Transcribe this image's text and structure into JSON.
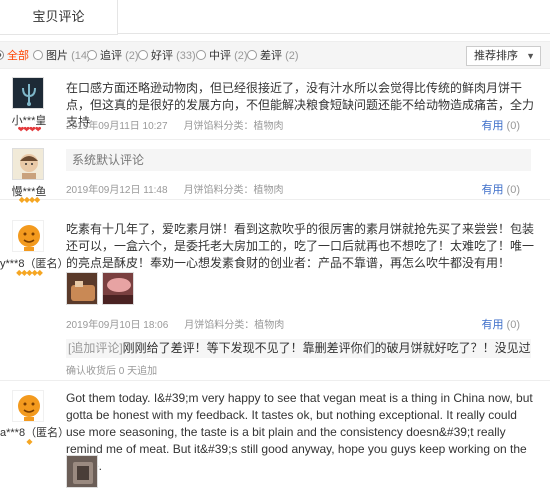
{
  "tab": {
    "label": "宝贝评论"
  },
  "filters": [
    {
      "label": "全部",
      "count": "",
      "checked": true
    },
    {
      "label": "图片",
      "count": "(14)",
      "checked": false
    },
    {
      "label": "追评",
      "count": "(2)",
      "checked": false
    },
    {
      "label": "好评",
      "count": "(33)",
      "checked": false
    },
    {
      "label": "中评",
      "count": "(2)",
      "checked": false
    },
    {
      "label": "差评",
      "count": "(2)",
      "checked": false
    }
  ],
  "sort": {
    "label": "推荐排序",
    "arrow": "▼"
  },
  "reviews": [
    {
      "user": "小***皇",
      "badges": "❤❤❤❤",
      "badge_color": "#e4393c",
      "content": "在口感方面还略逊动物肉，但已经很接近了，没有汁水所以会觉得比传统的鲜肉月饼干点，但这真的是很好的发展方向，不但能解决粮食短缺问题还能不给动物造成痛苦，全力支持",
      "date": "2019年09月11日 10:27",
      "category": "月饼馅料分类：植物肉",
      "useful_label": "有用",
      "useful_count": "(0)"
    },
    {
      "user": "慢***鱼",
      "badges": "◆◆◆◆",
      "badge_color": "#f5a623",
      "content": "系统默认评论",
      "date": "2019年09月12日 11:48",
      "category": "月饼馅料分类：植物肉",
      "useful_label": "有用",
      "useful_count": "(0)"
    },
    {
      "user": "y***8（匿名）",
      "badges": "◆◆◆◆◆",
      "badge_color": "#f5a623",
      "content": "吃素有十几年了，爱吃素月饼！看到这款吹乎的很厉害的素月饼就抢先买了来尝尝！包装还可以，一盒六个，是委托老大房加工的，吃了一口后就再也不想吃了！太难吃了！唯一的亮点是酥皮！奉劝一心想发素食财的创业者：产品不靠谱，再怎么吹牛都没有用！",
      "date": "2019年09月10日 18:06",
      "category": "月饼馅料分类：植物肉",
      "useful_label": "有用",
      "useful_count": "(0)",
      "append_tag": "[追加评论]",
      "append_text": "刚刚给了差评！等下发现不见了！靠删差评你们的破月饼就好吃了？！没见过这么差的！",
      "append_meta": "确认收货后 0 天追加"
    },
    {
      "user": "a***8（匿名）",
      "badges": "◆",
      "badge_color": "#f5a623",
      "content": "Got them today. I&#39;m very happy to see that vegan meat is a thing in China now, but gotta be honest with my feedback. It tastes ok, but nothing exceptional. It really could use more seasoning, the taste is a bit plain and the consistency doesn&#39;t really remind me of meat. But it&#39;s still good anyway, hope you guys keep working on the recipe."
    }
  ]
}
